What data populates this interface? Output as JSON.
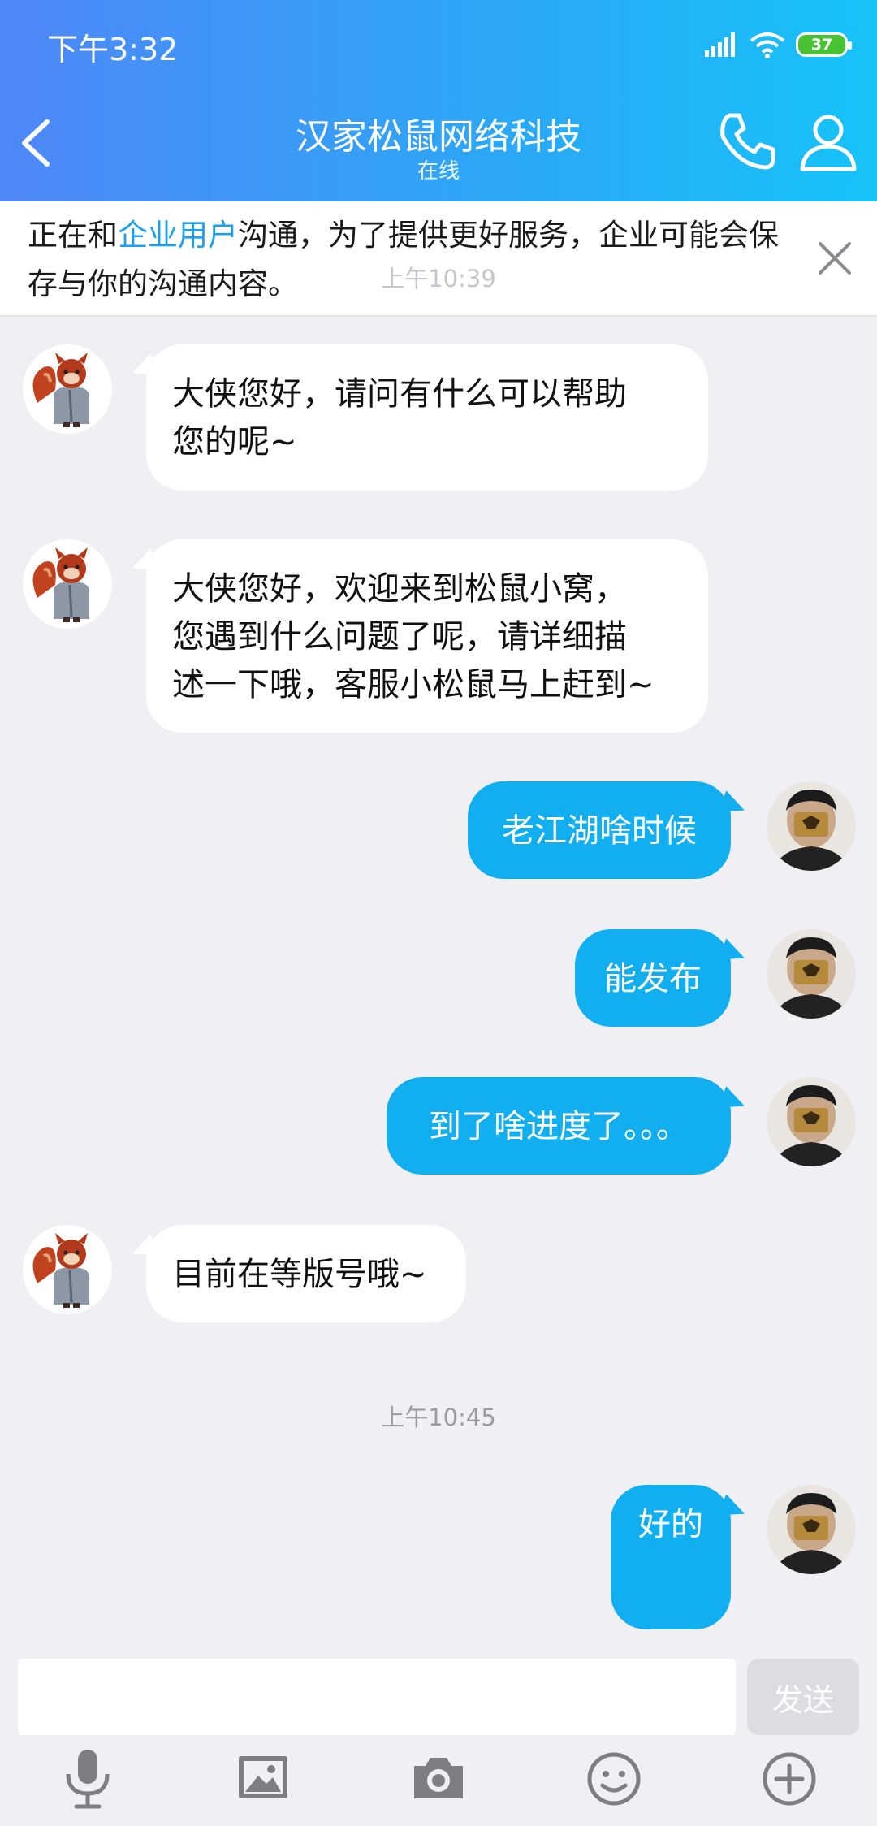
{
  "status_bar": {
    "time": "下午3:32",
    "battery": "37"
  },
  "header": {
    "title": "汉家松鼠网络科技",
    "subtitle": "在线"
  },
  "notice": {
    "text_before": "正在和",
    "link_text": "企业用户",
    "text_after": "沟通，为了提供更好服务，企业可能会保存与你的沟通内容。",
    "faded_time": "上午10:39"
  },
  "messages": [
    {
      "sender": "them",
      "text": "大侠您好，请问有什么可以帮助\n您的呢~"
    },
    {
      "sender": "them",
      "text": "大侠您好，欢迎来到松鼠小窝，\n您遇到什么问题了呢，请详细描\n述一下哦，客服小松鼠马上赶到~"
    },
    {
      "sender": "me",
      "text": "老江湖啥时候"
    },
    {
      "sender": "me",
      "text": "能发布"
    },
    {
      "sender": "me",
      "text": "到了啥进度了。。。"
    },
    {
      "sender": "them",
      "text": "目前在等版号哦~"
    },
    {
      "sender": "me",
      "text": "好的"
    }
  ],
  "timestamp": "上午10:45",
  "input": {
    "placeholder": "",
    "send_label": "发送"
  },
  "toolbar": [
    "microphone-icon",
    "image-icon",
    "camera-icon",
    "emoji-icon",
    "plus-icon"
  ],
  "colors": {
    "header_start": "#4f87f7",
    "header_end": "#16c3f9",
    "out_bubble": "#12aff0",
    "link": "#1aa0ef"
  }
}
